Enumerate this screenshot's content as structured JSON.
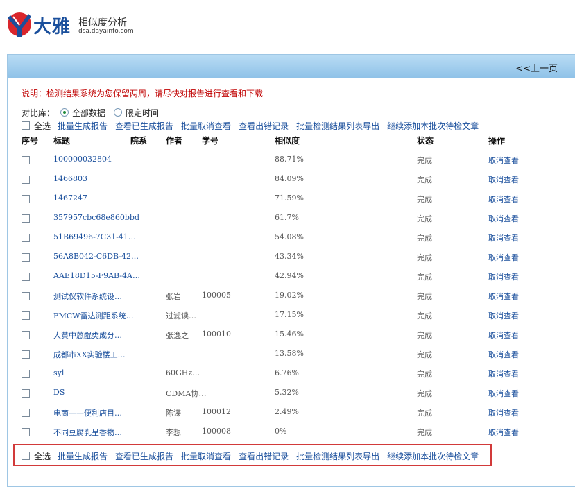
{
  "header": {
    "brand": "大雅",
    "subtitle": "相似度分析",
    "url": "dsa.dayainfo.com"
  },
  "panel": {
    "prev_label": "<<上一页"
  },
  "notice": "说明：检测结果系统为您保留两周，请尽快对报告进行查看和下载",
  "compare": {
    "label": "对比库：",
    "options": [
      "全部数据",
      "限定时间"
    ],
    "selected": "全部数据"
  },
  "toolbar": {
    "select_all": "全选",
    "actions": [
      "批量生成报告",
      "查看已生成报告",
      "批量取消查看",
      "查看出错记录",
      "批量检测结果列表导出",
      "继续添加本批次待检文章"
    ]
  },
  "table": {
    "headers": [
      "序号",
      "标题",
      "院系",
      "作者",
      "学号",
      "相似度",
      "状态",
      "操作"
    ],
    "rows": [
      {
        "title": "100000032804",
        "author": "",
        "sid": "",
        "sim": "88.71%",
        "status": "完成",
        "op": "取消查看"
      },
      {
        "title": "1466803",
        "author": "",
        "sid": "",
        "sim": "84.09%",
        "status": "完成",
        "op": "取消查看"
      },
      {
        "title": "1467247",
        "author": "",
        "sid": "",
        "sim": "71.59%",
        "status": "完成",
        "op": "取消查看"
      },
      {
        "title": "357957cbc68e860bbd",
        "author": "",
        "sid": "",
        "sim": "61.7%",
        "status": "完成",
        "op": "取消查看"
      },
      {
        "title": "51B69496-7C31-41…",
        "author": "",
        "sid": "",
        "sim": "54.08%",
        "status": "完成",
        "op": "取消查看"
      },
      {
        "title": "56A8B042-C6DB-42…",
        "author": "",
        "sid": "",
        "sim": "43.34%",
        "status": "完成",
        "op": "取消查看"
      },
      {
        "title": "AAE18D15-F9AB-4A…",
        "author": "",
        "sid": "",
        "sim": "42.94%",
        "status": "完成",
        "op": "取消查看"
      },
      {
        "title": "测试仪软件系统设…",
        "author": "张岩",
        "sid": "100005",
        "sim": "19.02%",
        "status": "完成",
        "op": "取消查看"
      },
      {
        "title": "FMCW雷达测距系统…",
        "author": "过滤读…",
        "sid": "",
        "sim": "17.15%",
        "status": "完成",
        "op": "取消查看"
      },
      {
        "title": "大黄中蒽醌类成分…",
        "author": "张逸之",
        "sid": "100010",
        "sim": "15.46%",
        "status": "完成",
        "op": "取消查看"
      },
      {
        "title": "成都市XX实验楼工…",
        "author": "",
        "sid": "",
        "sim": "13.58%",
        "status": "完成",
        "op": "取消查看"
      },
      {
        "title": "syl",
        "author": "60GHz…",
        "sid": "",
        "sim": "6.76%",
        "status": "完成",
        "op": "取消查看"
      },
      {
        "title": "DS",
        "author": "CDMA协…",
        "sid": "",
        "sim": "5.32%",
        "status": "完成",
        "op": "取消查看"
      },
      {
        "title": "电商——便利店目…",
        "author": "陈谍",
        "sid": "100012",
        "sim": "2.49%",
        "status": "完成",
        "op": "取消查看"
      },
      {
        "title": "不同豆腐乳呈香物…",
        "author": "李想",
        "sid": "100008",
        "sim": "0%",
        "status": "完成",
        "op": "取消查看"
      }
    ]
  },
  "colors": {
    "brand_blue": "#1a4f9c",
    "logo_red": "#d9262c",
    "notice_red": "#c00000",
    "bar_blue": "#a6d0ef",
    "highlight_red": "#d23a3a"
  }
}
